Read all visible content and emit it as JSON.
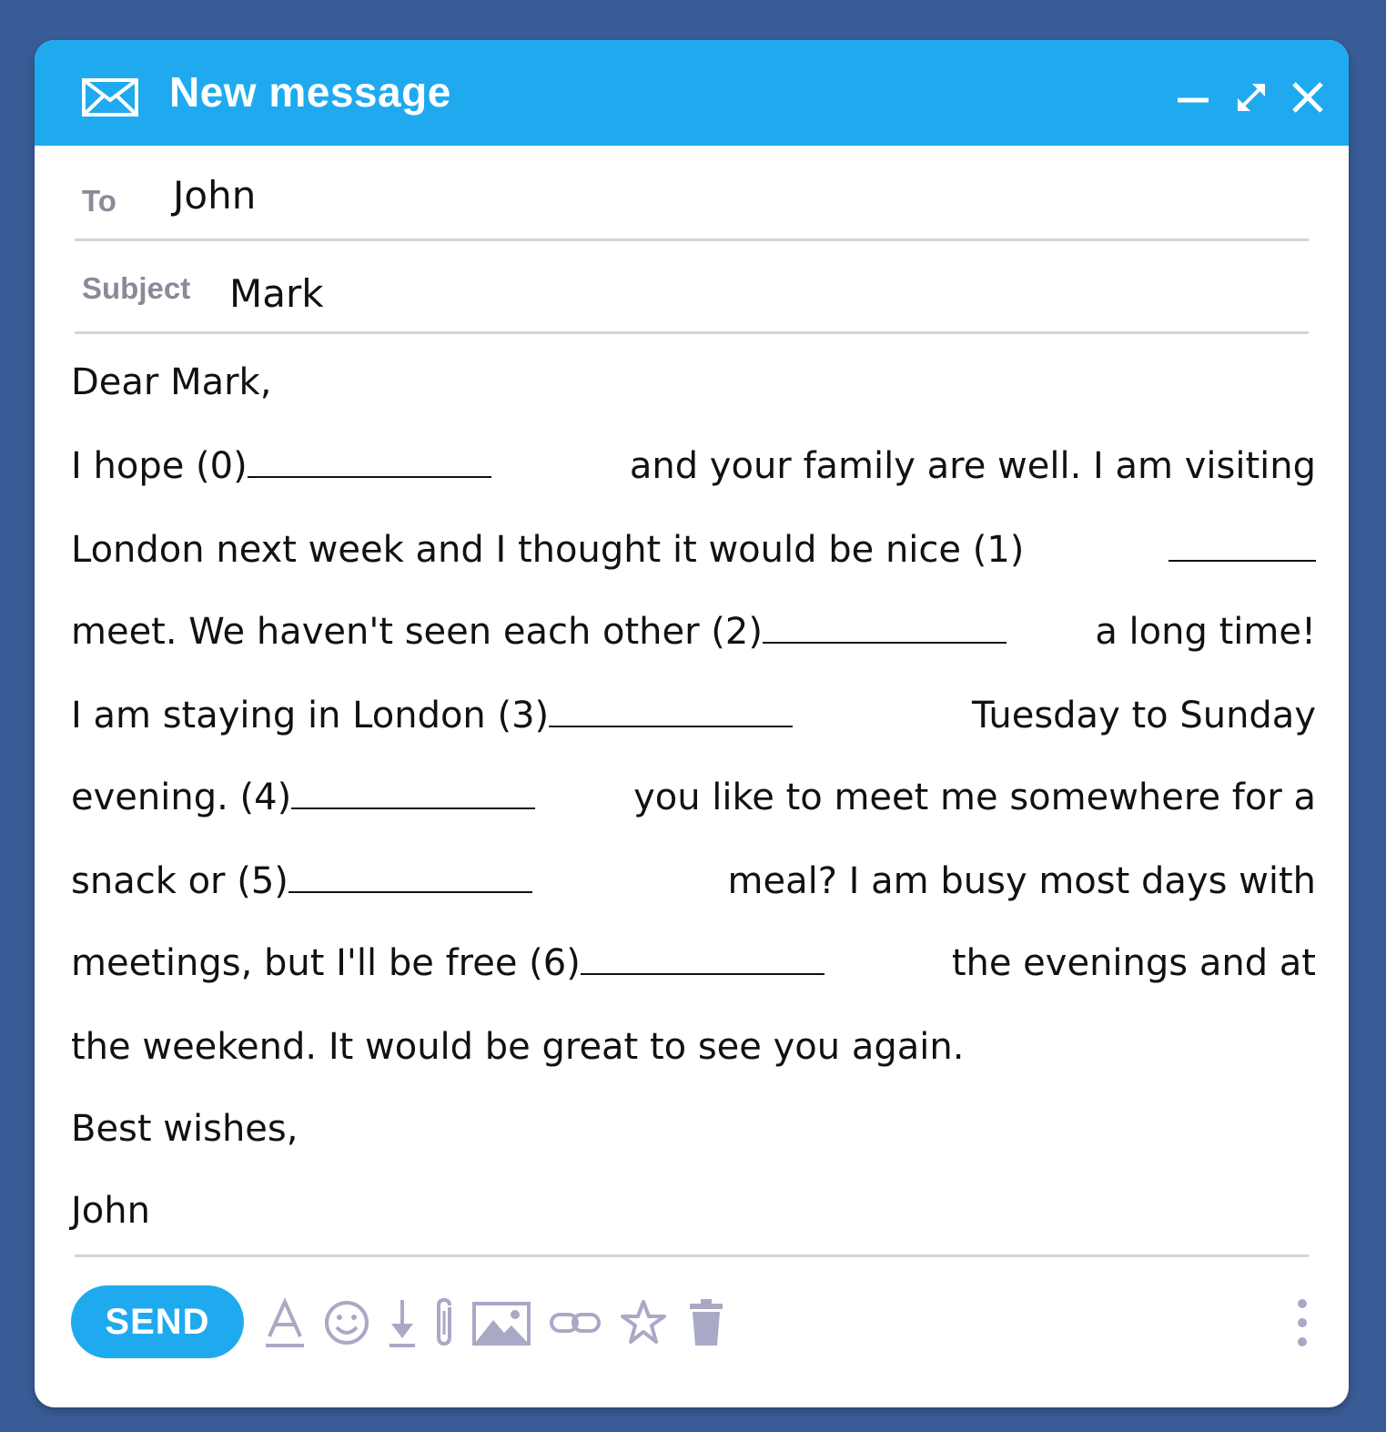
{
  "window": {
    "title": "New message",
    "title_icon": "envelope-icon",
    "controls": [
      "minimize-icon",
      "expand-icon",
      "close-icon"
    ]
  },
  "to": {
    "label": "To",
    "value": "John"
  },
  "subject": {
    "label": "Subject",
    "value": "Mark"
  },
  "letter": {
    "salutation": "Dear Mark,",
    "line1": {
      "a": "I hope (0)",
      "b": "and your family are well. I am visiting"
    },
    "line2": {
      "a": "London next week and I thought it would be nice (1)"
    },
    "line3": {
      "a": "meet. We haven't seen each other (2)",
      "b": "a long time!"
    },
    "line4": {
      "a": "I am staying in London (3)",
      "b": "Tuesday to Sunday"
    },
    "line5": {
      "a": "evening. (4)",
      "b": "you like to meet me somewhere for a"
    },
    "line6": {
      "a": "snack or (5)",
      "b": "meal? I am busy most days with"
    },
    "line7": {
      "a": "meetings, but I'll be free (6)",
      "b": "the evenings and at"
    },
    "line8": "the weekend. It would be great to see you again.",
    "closing": "Best wishes,",
    "signature": "John"
  },
  "toolbar": {
    "send_label": "SEND",
    "tools": [
      "text-format-icon",
      "emoji-icon",
      "download-icon",
      "attachment-icon",
      "image-icon",
      "link-icon",
      "star-icon",
      "trash-icon",
      "more-options-icon"
    ]
  },
  "colors": {
    "accent": "#1faaf0",
    "background": "#3a5c96",
    "icon_gray": "#a9a9c6"
  }
}
